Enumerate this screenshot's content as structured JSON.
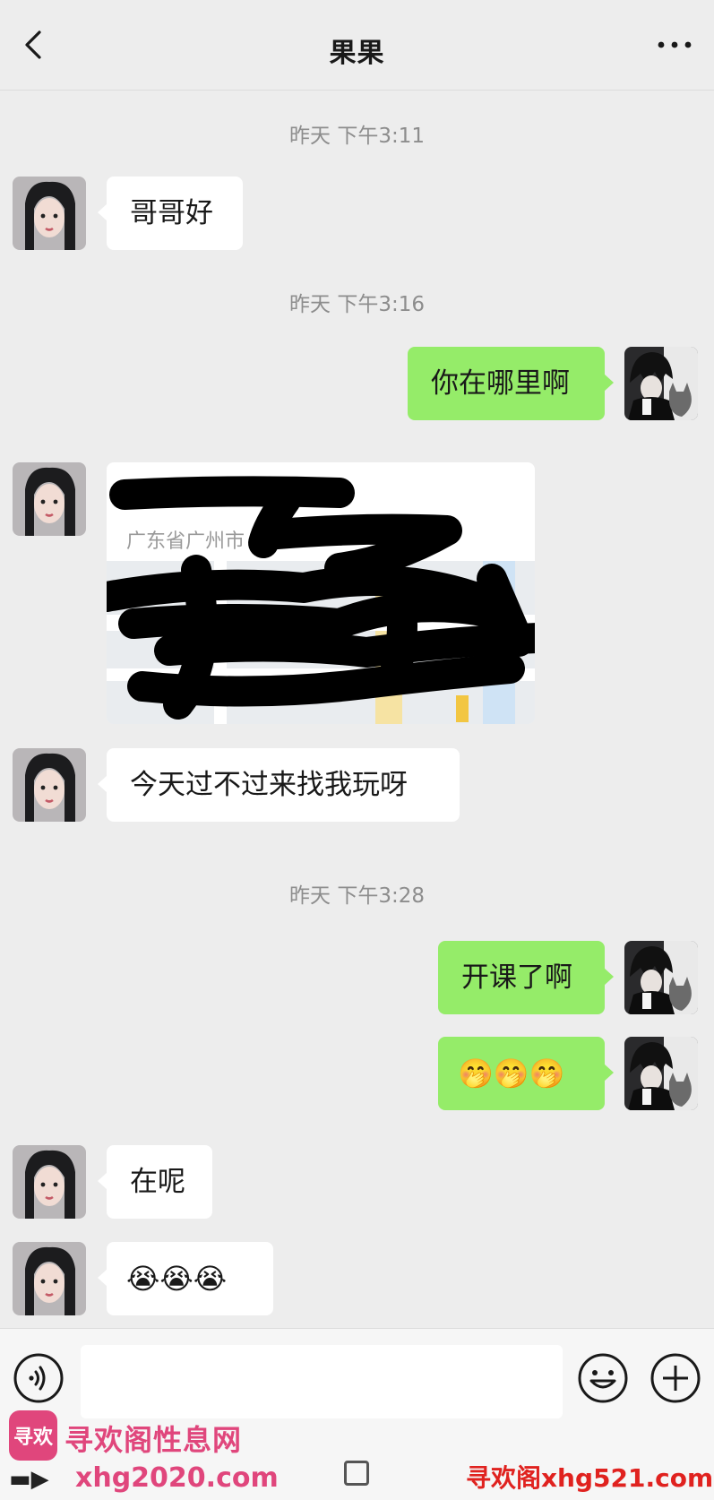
{
  "header": {
    "title": "果果"
  },
  "messages": {
    "ts1": "昨天 下午3:11",
    "m1": "哥哥好",
    "ts2": "昨天 下午3:16",
    "m2": "你在哪里啊",
    "loc_addr": "广东省广州市",
    "m3": "今天过不过来找我玩呀",
    "ts3": "昨天 下午3:28",
    "m4": "开课了啊",
    "m5": "🤭🤭🤭",
    "m6": "在呢",
    "m7": "😭😭😭"
  },
  "watermark": {
    "logo": "寻欢",
    "title": "寻欢阁性息网",
    "url_left": "xhg2020.com",
    "url_right": "寻欢阁xhg521.com"
  },
  "colors": {
    "sent_bubble": "#95ec69",
    "received_bubble": "#ffffff",
    "background": "#ededed",
    "redaction": "#000000"
  }
}
